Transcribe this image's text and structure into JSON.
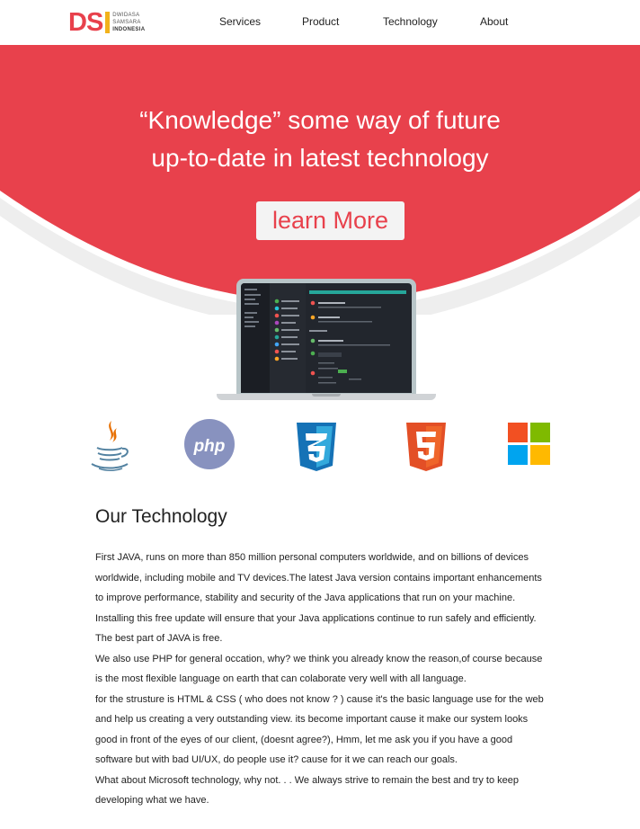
{
  "brand": {
    "mark": "DSI",
    "line1": "DWIDASA",
    "line2": "SAMSARA",
    "line3": "INDONESIA"
  },
  "nav": {
    "services": "Services",
    "product": "Product",
    "technology": "Technology",
    "about": "About"
  },
  "hero": {
    "line1": "“Knowledge” some way of future",
    "line2": "up-to-date in latest technology",
    "cta": "learn More"
  },
  "tech_icons": [
    "java-icon",
    "php-icon",
    "css3-icon",
    "html5-icon",
    "microsoft-icon"
  ],
  "php_label": "php",
  "section": {
    "title": "Our Technology",
    "paragraphs": [
      "First JAVA, runs on more than 850 million personal computers worldwide, and on billions of devices worldwide, including mobile and TV devices.The latest Java version contains important enhancements to improve performance, stability and security of the Java applications that run on your machine. Installing this free update will ensure that your Java applications continue to run safely and efficiently. The best part of JAVA is free.",
      "We also use PHP for general occation, why? we think you already know the reason,of course because is the most flexible language on earth that can colaborate very well with all language.",
      "for the strusture is HTML & CSS ( who does not know ? ) cause it's the basic language use for the web and help us creating a very outstanding view. its become important cause it make our system looks good in front of the eyes of our client, (doesnt agree?), Hmm, let me ask you if you have a good software but with bad UI/UX, do people use it? cause for it we can reach our goals.",
      "What about Microsoft technology, why not. . . We always strive to remain the best and try to keep developing what we have."
    ]
  },
  "colors": {
    "accent": "#e8414c",
    "button_bg": "#f3f3f3",
    "swoosh": "#eeeeee"
  }
}
